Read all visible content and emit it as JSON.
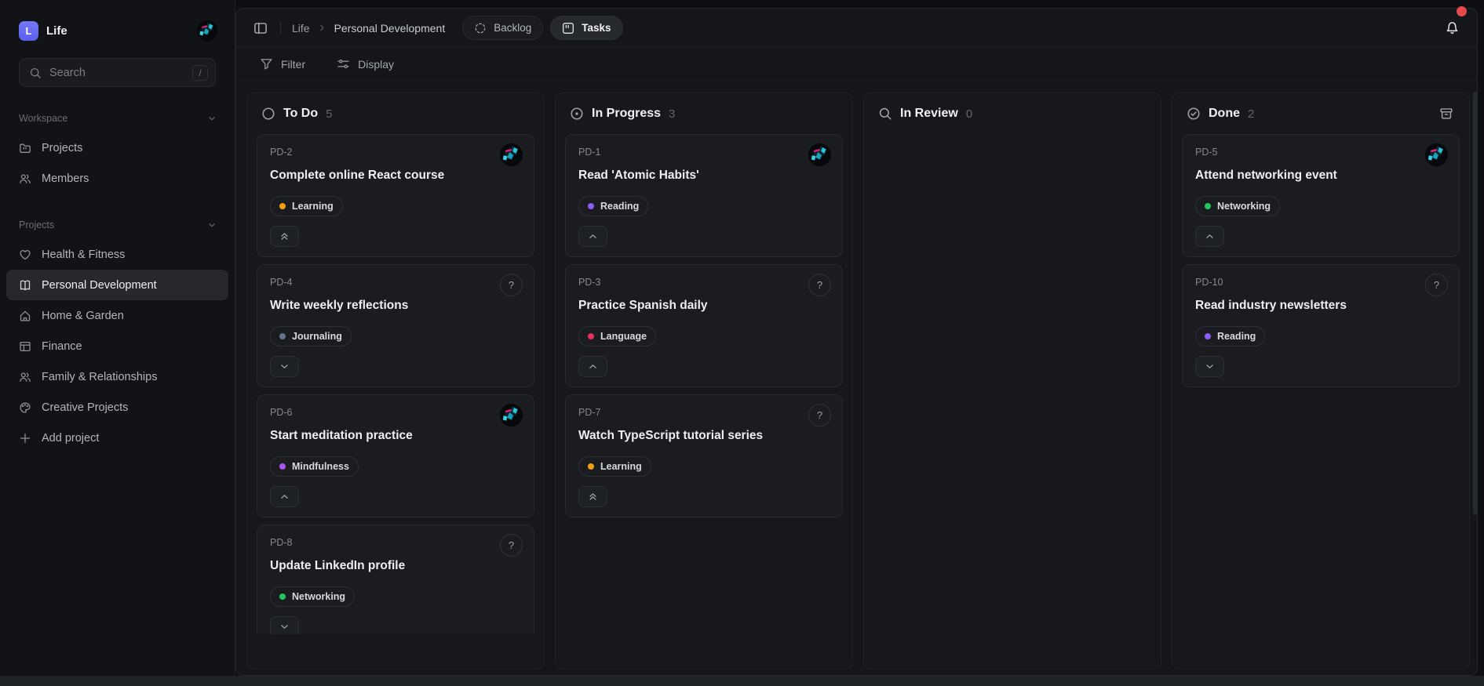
{
  "app": {
    "logo_letter": "L",
    "name": "Life"
  },
  "sidebar": {
    "search": {
      "placeholder": "Search",
      "shortcut": "/"
    },
    "sections": [
      {
        "label": "Workspace",
        "items": [
          {
            "icon": "folder",
            "label": "Projects"
          },
          {
            "icon": "users",
            "label": "Members"
          }
        ]
      },
      {
        "label": "Projects",
        "items": [
          {
            "icon": "heart",
            "label": "Health & Fitness"
          },
          {
            "icon": "book",
            "label": "Personal Development",
            "active": true
          },
          {
            "icon": "home",
            "label": "Home & Garden"
          },
          {
            "icon": "table",
            "label": "Finance"
          },
          {
            "icon": "users",
            "label": "Family & Relationships"
          },
          {
            "icon": "palette",
            "label": "Creative Projects"
          },
          {
            "icon": "plus",
            "label": "Add project"
          }
        ]
      }
    ]
  },
  "header": {
    "breadcrumb": {
      "root": "Life",
      "current": "Personal Development"
    },
    "tabs": [
      {
        "icon": "dashed-circle",
        "label": "Backlog"
      },
      {
        "icon": "board",
        "label": "Tasks",
        "active": true
      }
    ],
    "notification_dot_color": "#e5484d"
  },
  "toolbar": {
    "filter_label": "Filter",
    "display_label": "Display"
  },
  "board": {
    "columns": [
      {
        "icon": "circle",
        "name": "To Do",
        "count": "5",
        "cards": [
          {
            "id": "PD-2",
            "title": "Complete online React course",
            "tag": "Learning",
            "tag_color": "#f59e0b",
            "assignee": "avatar",
            "priority": "urgent"
          },
          {
            "id": "PD-4",
            "title": "Write weekly reflections",
            "tag": "Journaling",
            "tag_color": "#64748b",
            "assignee": "unassigned",
            "priority": "low"
          },
          {
            "id": "PD-6",
            "title": "Start meditation practice",
            "tag": "Mindfulness",
            "tag_color": "#a855f7",
            "assignee": "avatar",
            "priority": "medium"
          },
          {
            "id": "PD-8",
            "title": "Update LinkedIn profile",
            "tag": "Networking",
            "tag_color": "#22c55e",
            "assignee": "unassigned",
            "priority": "low"
          }
        ]
      },
      {
        "icon": "circle-dot",
        "name": "In Progress",
        "count": "3",
        "cards": [
          {
            "id": "PD-1",
            "title": "Read 'Atomic Habits'",
            "tag": "Reading",
            "tag_color": "#8b5cf6",
            "assignee": "avatar",
            "priority": "medium"
          },
          {
            "id": "PD-3",
            "title": "Practice Spanish daily",
            "tag": "Language",
            "tag_color": "#e8305c",
            "assignee": "unassigned",
            "priority": "medium"
          },
          {
            "id": "PD-7",
            "title": "Watch TypeScript tutorial series",
            "tag": "Learning",
            "tag_color": "#f59e0b",
            "assignee": "unassigned",
            "priority": "urgent"
          }
        ]
      },
      {
        "icon": "magnifier",
        "name": "In Review",
        "count": "0",
        "cards": []
      },
      {
        "icon": "check-circle",
        "name": "Done",
        "count": "2",
        "archive_button": true,
        "cards": [
          {
            "id": "PD-5",
            "title": "Attend networking event",
            "tag": "Networking",
            "tag_color": "#22c55e",
            "assignee": "avatar",
            "priority": "medium"
          },
          {
            "id": "PD-10",
            "title": "Read industry newsletters",
            "tag": "Reading",
            "tag_color": "#8b5cf6",
            "assignee": "unassigned",
            "priority": "low"
          }
        ]
      }
    ]
  }
}
